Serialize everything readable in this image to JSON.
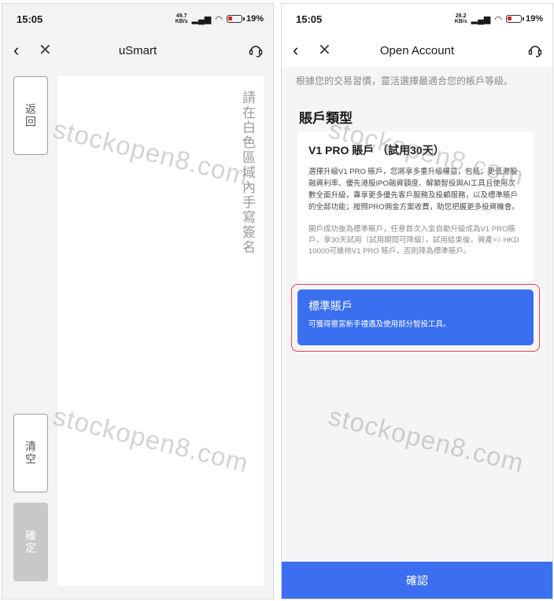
{
  "left_screen": {
    "status": {
      "time": "15:05",
      "speed": "49.7",
      "speed_unit": "KB/s",
      "battery": "19",
      "battery_unit": "%"
    },
    "nav": {
      "back_icon": "‹",
      "close_icon": "✕",
      "title": "uSmart"
    },
    "signature_hint": "請在白色區域內手寫簽名",
    "buttons": {
      "back": "返回",
      "clear": "清空",
      "confirm": "確定"
    }
  },
  "right_screen": {
    "status": {
      "time": "15:05",
      "speed": "26.2",
      "speed_unit": "KB/s",
      "battery": "19",
      "battery_unit": "%"
    },
    "nav": {
      "back_icon": "‹",
      "close_icon": "✕",
      "title": "Open Account"
    },
    "intro": "根據您的交易習慣，靈活選擇最適合您的帳戶等級。",
    "section_title": "賬戶類型",
    "cards": [
      {
        "title": "V1 PRO 賬戶 （試用30天）",
        "desc": "選擇升級V1 PRO 賬戶，您將享多重升級權益，包括：更低港股融資利率、優先港股IPO融資額度、解鎖智投與AI工具且使用次數全面升級，專享更多優先客戶服務及投顧服務，以及標準賬戶的全部功能；按照PRO佣金方案收費，助您把握更多投資機會。",
        "note": "開戶成功後為標準賬戶，任意首次入金自動升級成為V1 PRO賬戶，享30天試用（試用期間可降級），試用結束後，資產>= HKD 10000可維持V1 PRO 賬戶，否則降為標準賬戶。"
      },
      {
        "title": "標準賬戶",
        "desc": "可獲得豐富新手禮遇及使用部分智投工具。"
      }
    ],
    "confirm": "確認"
  },
  "watermark": "stockopen8.com",
  "colors": {
    "primary": "#3b6ff0",
    "selected_border": "#e04545",
    "disabled": "#c8c8c8"
  }
}
